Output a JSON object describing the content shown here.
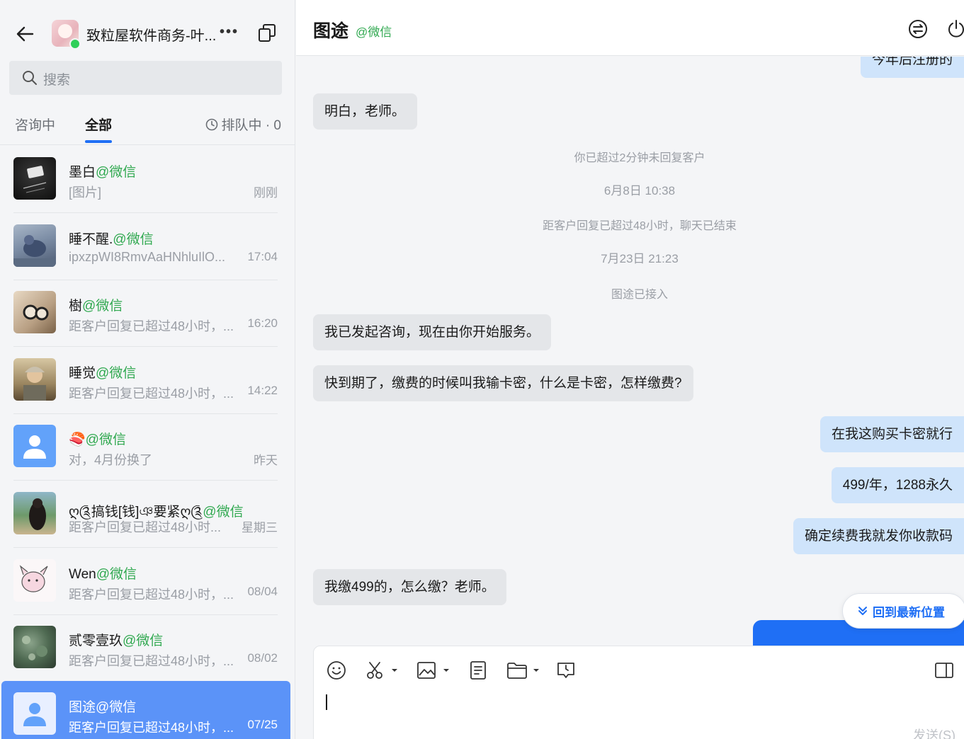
{
  "sidebar": {
    "account_name": "致粒屋软件商务-叶...",
    "more_label": "•••",
    "search_placeholder": "搜索",
    "tabs": [
      {
        "label": "咨询中"
      },
      {
        "label": "全部"
      }
    ],
    "queue_label": "排队中 · 0",
    "conversations": [
      {
        "name": "墨白",
        "source": "@微信",
        "preview": "[图片]",
        "time": "刚刚"
      },
      {
        "name": "睡不醒.",
        "source": "@微信",
        "preview": "ipxzpWI8RmvAaHNhluIlO...",
        "time": "17:04"
      },
      {
        "name": "樹",
        "source": "@微信",
        "preview": "距客户回复已超过48小时，...",
        "time": "16:20"
      },
      {
        "name": "睡觉",
        "source": "@微信",
        "preview": "距客户回复已超过48小时，...",
        "time": "14:22"
      },
      {
        "name": "🍣",
        "source": "@微信",
        "preview": "对，4月份换了",
        "time": "昨天"
      },
      {
        "name": "ღ༊搞钱[钱]ঞ要紧ღ༊",
        "source": "@微信",
        "preview": "距客户回复已超过48小时...",
        "time": "星期三"
      },
      {
        "name": "Wen",
        "source": "@微信",
        "preview": "距客户回复已超过48小时，...",
        "time": "08/04"
      },
      {
        "name": "贰零壹玖",
        "source": "@微信",
        "preview": "距客户回复已超过48小时，...",
        "time": "08/02"
      },
      {
        "name": "图途",
        "source": "@微信",
        "preview": "距客户回复已超过48小时，...",
        "time": "07/25"
      }
    ]
  },
  "chat": {
    "title": "图途",
    "source": "@微信",
    "messages": {
      "top_partial": "今年后注册的",
      "m1": "明白，老师。",
      "sys1": "你已超过2分钟未回复客户",
      "sys2": "6月8日 10:38",
      "sys3": "距客户回复已超过48小时，聊天已结束",
      "sys4": "7月23日 21:23",
      "sys5": "图途已接入",
      "m2": "我已发起咨询，现在由你开始服务。",
      "m3": "快到期了，缴费的时候叫我输卡密，什么是卡密，怎样缴费?",
      "m4": "在我这购买卡密就行",
      "m5": "499/年，1288永久",
      "m6": "确定续费我就发你收款码",
      "m7": "我缴499的，怎么缴？老师。"
    },
    "jump_label": "回到最新位置",
    "send_label": "发送(S)"
  },
  "colors": {
    "accent": "#1f6ff5",
    "selected_row": "#5b93f8",
    "wechat_green": "#2fa84f",
    "out_bubble": "#cfe4fb",
    "in_bubble": "#e4e6e9"
  }
}
